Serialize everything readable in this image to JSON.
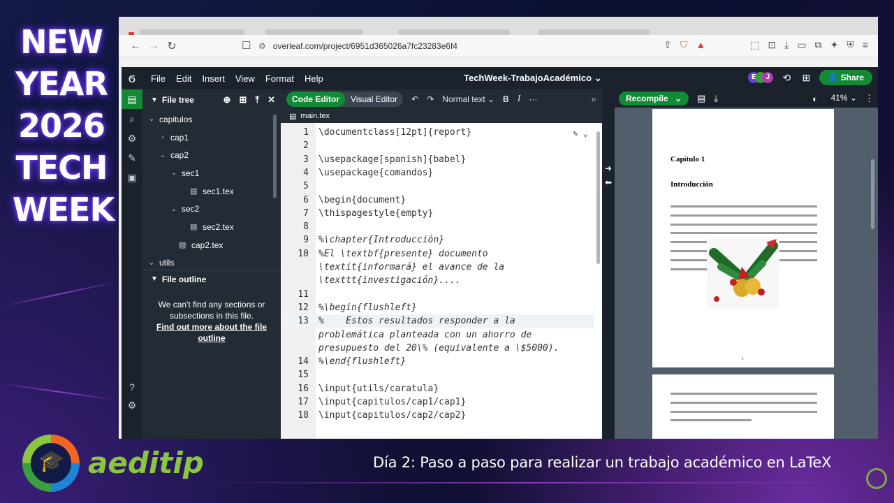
{
  "overlay": {
    "title_lines": [
      "NEW",
      "YEAR",
      "2026",
      "TECH",
      "WEEK"
    ],
    "brand": "aeditip",
    "caption": "Día 2: Paso a paso para realizar un trabajo académico en LaTeX"
  },
  "browser": {
    "url": "overleaf.com/project/6951d365026a7fc23283e6f4"
  },
  "app": {
    "menu": [
      "File",
      "Edit",
      "Insert",
      "View",
      "Format",
      "Help"
    ],
    "project_title": "TechWeek-TrabajoAcadémico",
    "avatars": [
      {
        "letter": "E",
        "color": "#6a3fd6"
      },
      {
        "letter": "",
        "color": "#3a9f3f"
      },
      {
        "letter": "J",
        "color": "#b03ab0"
      }
    ],
    "share_label": "Share"
  },
  "sidebar": {
    "file_tree_label": "File tree",
    "tree": [
      {
        "label": "capitulos",
        "indent": 0,
        "kind": "folder-open"
      },
      {
        "label": "cap1",
        "indent": 1,
        "kind": "folder-closed"
      },
      {
        "label": "cap2",
        "indent": 1,
        "kind": "folder-open"
      },
      {
        "label": "sec1",
        "indent": 2,
        "kind": "folder-open"
      },
      {
        "label": "sec1.tex",
        "indent": 3,
        "kind": "file"
      },
      {
        "label": "sec2",
        "indent": 2,
        "kind": "folder-open"
      },
      {
        "label": "sec2.tex",
        "indent": 3,
        "kind": "file"
      },
      {
        "label": "cap2.tex",
        "indent": 2,
        "kind": "file"
      },
      {
        "label": "utils",
        "indent": 0,
        "kind": "folder-open"
      }
    ],
    "outline_label": "File outline",
    "outline_msg": "We can't find any sections or subsections in this file.",
    "outline_link": "Find out more about the file outline"
  },
  "editor": {
    "code_editor_label": "Code Editor",
    "visual_editor_label": "Visual Editor",
    "text_style": "Normal text",
    "bold_label": "B",
    "italic_label": "I",
    "file_name": "main.tex",
    "lines": [
      {
        "num": "1",
        "text": "\\documentclass[12pt]{report}",
        "comment": false
      },
      {
        "num": "2",
        "text": "",
        "comment": false
      },
      {
        "num": "3",
        "text": "\\usepackage[spanish]{babel}",
        "comment": false
      },
      {
        "num": "4",
        "text": "\\usepackage{comandos}",
        "comment": false
      },
      {
        "num": "5",
        "text": "",
        "comment": false
      },
      {
        "num": "6",
        "text": "\\begin{document}",
        "comment": false
      },
      {
        "num": "7",
        "text": "\\thispagestyle{empty}",
        "comment": false
      },
      {
        "num": "8",
        "text": "",
        "comment": false
      },
      {
        "num": "9",
        "text": "%\\chapter{Introducción}",
        "comment": true
      },
      {
        "num": "10",
        "text": "%El \\textbf{presente} documento",
        "comment": true
      },
      {
        "num": "",
        "text": "\\textit{informará} el avance de la",
        "comment": true
      },
      {
        "num": "",
        "text": "\\texttt{investigación}....",
        "comment": true
      },
      {
        "num": "11",
        "text": "",
        "comment": false
      },
      {
        "num": "12",
        "text": "%\\begin{flushleft}",
        "comment": true
      },
      {
        "num": "13",
        "text": "%    Estos resultados responder a la",
        "comment": true
      },
      {
        "num": "",
        "text": "problemática planteada con un ahorro de",
        "comment": true
      },
      {
        "num": "",
        "text": "presupuesto del 20\\% (equivalente a \\$5000).",
        "comment": true
      },
      {
        "num": "14",
        "text": "%\\end{flushleft}",
        "comment": true
      },
      {
        "num": "15",
        "text": "",
        "comment": false
      },
      {
        "num": "16",
        "text": "\\input{utils/caratula}",
        "comment": false
      },
      {
        "num": "17",
        "text": "\\input{capitulos/cap1/cap1}",
        "comment": false
      },
      {
        "num": "18",
        "text": "\\input{capitulos/cap2/cap2}",
        "comment": false
      }
    ]
  },
  "pdf": {
    "recompile_label": "Recompile",
    "zoom": "41%",
    "chapter": "Capítulo 1",
    "section": "Introducción",
    "page_number": "1"
  }
}
